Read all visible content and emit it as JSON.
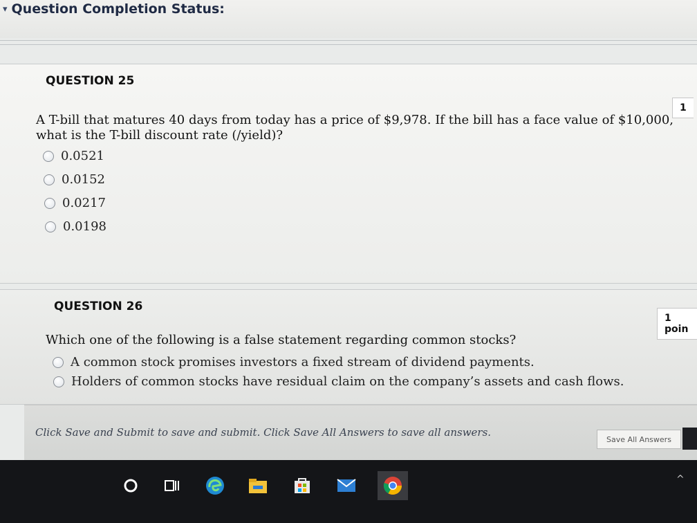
{
  "header": {
    "title": "Question Completion Status:"
  },
  "questions": [
    {
      "number_label": "QUESTION 25",
      "points": "1",
      "text_line1": "A T-bill that matures 40 days from today has a price of $9,978. If the bill has a face value of $10,000,",
      "text_line2": "what is the T-bill discount rate (/yield)?",
      "options": [
        "0.0521",
        "0.0152",
        "0.0217",
        "0.0198"
      ]
    },
    {
      "number_label": "QUESTION 26",
      "points": "1 poin",
      "text_line1": "Which one of the following is a false statement regarding common stocks?",
      "options": [
        "A common stock promises investors a fixed stream of dividend payments.",
        "Holders of common stocks have residual claim on the company’s assets and cash flows."
      ]
    }
  ],
  "footer": {
    "instruction": "Click Save and Submit to save and submit. Click Save All Answers to save all answers.",
    "save_all_label": "Save All Answers"
  },
  "taskbar": {
    "icons": [
      "search-circle-icon",
      "task-view-icon",
      "edge-browser-icon",
      "file-explorer-icon",
      "store-icon",
      "mail-icon",
      "chrome-icon"
    ],
    "tray": "^"
  }
}
